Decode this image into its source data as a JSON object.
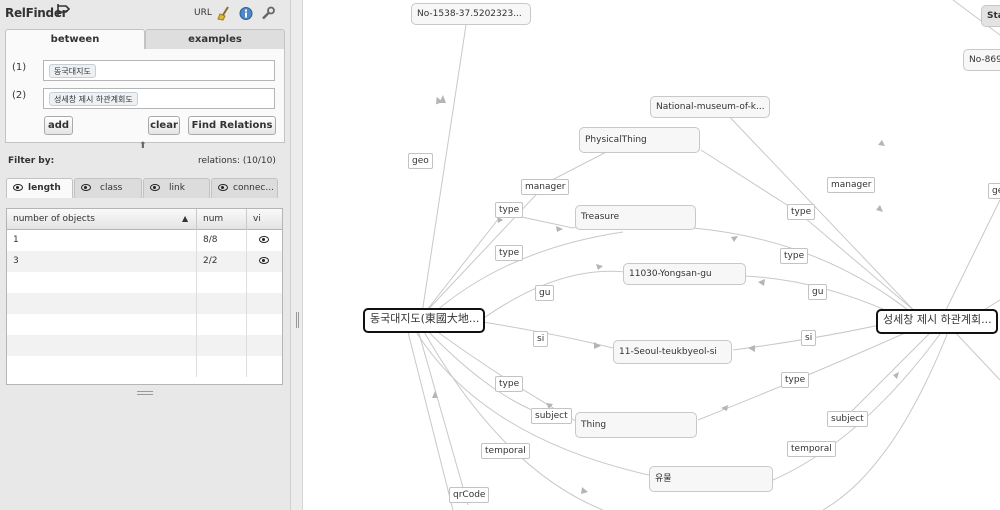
{
  "app": {
    "title": "RelFinder",
    "url_label": "URL"
  },
  "tabs": [
    {
      "label": "between"
    },
    {
      "label": "examples"
    }
  ],
  "query": {
    "q1_label": "(1)",
    "q1_value": "동국대지도",
    "q2_label": "(2)",
    "q2_value": "성세창 제시 하관계회도"
  },
  "buttons": {
    "add": "add",
    "clear": "clear",
    "find": "Find Relations"
  },
  "filter": {
    "title": "Filter by:",
    "relations": "relations: (10/10)",
    "tabs": [
      {
        "label": "length"
      },
      {
        "label": "class"
      },
      {
        "label": "link"
      },
      {
        "label": "connec..."
      }
    ]
  },
  "table": {
    "headers": [
      "number of objects",
      "num",
      "vi"
    ],
    "sort_indicator": "▲",
    "rows": [
      {
        "objects": "1",
        "num": "8/8"
      },
      {
        "objects": "3",
        "num": "2/2"
      }
    ]
  },
  "graph": {
    "nodes": {
      "left_focus": "동국대지도(東國大地...",
      "right_focus": "성세창 제시 하관계회...",
      "geo_top": "No-1538-37.5202323...",
      "geo_right": "No-869",
      "right_top": "Sta",
      "museum": "National-museum-of-k...",
      "physical": "PhysicalThing",
      "treasure": "Treasure",
      "yongsan": "11030-Yongsan-gu",
      "seoul": "11-Seoul-teukbyeol-si",
      "thing": "Thing",
      "yumul": "유물"
    },
    "edges": {
      "geo": "geo",
      "manager_l": "manager",
      "type_l1": "type",
      "type_l2": "type",
      "gu_l": "gu",
      "si_l": "si",
      "type_l3": "type",
      "subject_l": "subject",
      "temporal_l": "temporal",
      "qrcode": "qrCode",
      "manager_r": "manager",
      "type_r1": "type",
      "type_r2": "type",
      "gu_r": "gu",
      "si_r": "si",
      "type_r3": "type",
      "subject_r": "subject",
      "temporal_r": "temporal",
      "ge_r": "ge"
    }
  },
  "colors": {
    "panel_bg": "#e8e8e8",
    "edge": "#c8c8c8",
    "focus_border": "#111111"
  }
}
